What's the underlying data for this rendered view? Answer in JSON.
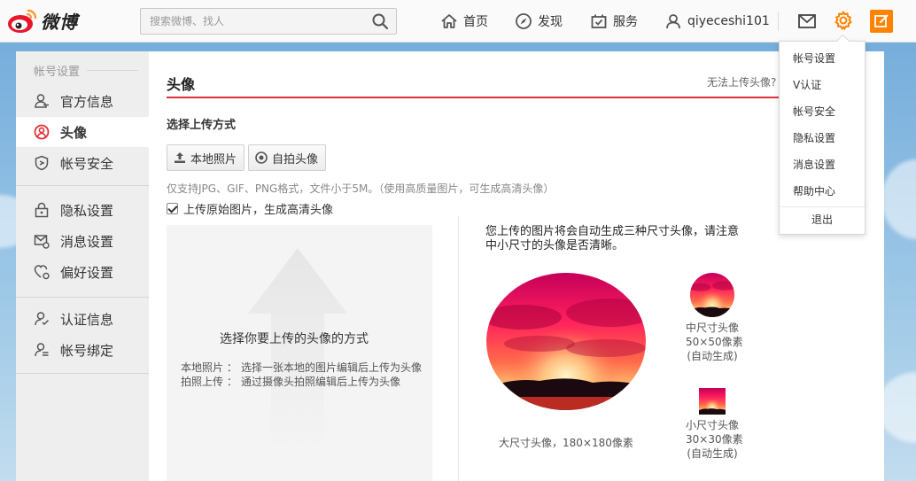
{
  "header": {
    "logo_text": "微博",
    "search": {
      "placeholder": "搜索微博、找人",
      "value": ""
    },
    "nav": [
      {
        "label": "首页",
        "icon": "home-icon"
      },
      {
        "label": "发现",
        "icon": "compass-icon"
      },
      {
        "label": "服务",
        "icon": "service-icon"
      },
      {
        "label": "qiyeceshi101",
        "icon": "user-icon"
      }
    ],
    "colors": {
      "accent": "#ff8200"
    }
  },
  "sidebar": {
    "section_title": "帐号设置",
    "items": [
      {
        "label": "官方信息",
        "icon": "user-info-icon"
      },
      {
        "label": "头像",
        "icon": "avatar-icon",
        "active": true
      },
      {
        "label": "帐号安全",
        "icon": "shield-icon"
      },
      {
        "label": "隐私设置",
        "icon": "lock-icon"
      },
      {
        "label": "消息设置",
        "icon": "message-settings-icon"
      },
      {
        "label": "偏好设置",
        "icon": "heart-settings-icon"
      },
      {
        "label": "认证信息",
        "icon": "verified-user-icon"
      },
      {
        "label": "帐号绑定",
        "icon": "bind-account-icon"
      }
    ]
  },
  "main": {
    "title": "头像",
    "help_link": "无法上传头像?",
    "method_title": "选择上传方式",
    "buttons": {
      "local_photo": "本地照片",
      "selfie": "自拍头像"
    },
    "hint": "仅支持JPG、GIF、PNG格式，文件小于5M。（使用高质量图片，可生成高清头像）",
    "checkbox_label": "上传原始图片，生成高清头像",
    "checkbox_checked": true,
    "drop_area": {
      "title": "选择你要上传的头像的方式",
      "lines": [
        {
          "key": "本地照片 ：",
          "value": "选择一张本地的图片编辑后上传为头像"
        },
        {
          "key": "拍照上传 ：",
          "value": "通过摄像头拍照编辑后上传为头像"
        }
      ]
    },
    "preview": {
      "note": "您上传的图片将会自动生成三种尺寸头像，请注意中小尺寸的头像是否清晰。",
      "large_caption": "大尺寸头像，180×180像素",
      "medium_caption": [
        "中尺寸头像",
        "50×50像素",
        "(自动生成)"
      ],
      "small_caption": [
        "小尺寸头像",
        "30×30像素",
        "(自动生成)"
      ]
    }
  },
  "dropdown": {
    "items": [
      "帐号设置",
      "V认证",
      "帐号安全",
      "隐私设置",
      "消息设置",
      "帮助中心"
    ],
    "logout": "退出"
  }
}
